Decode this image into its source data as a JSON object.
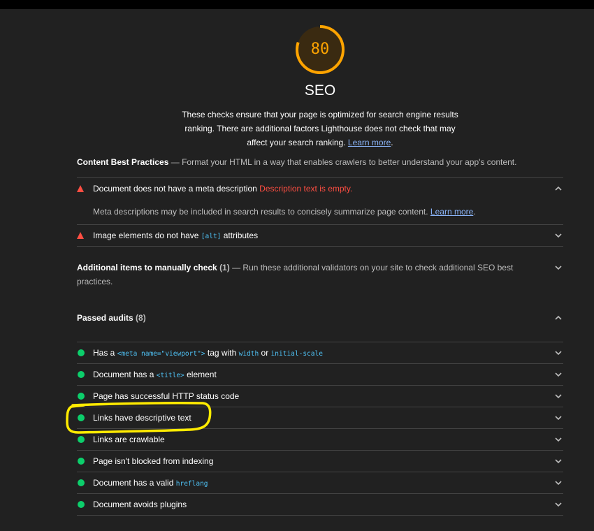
{
  "score": {
    "value": "80",
    "fraction": 0.8,
    "color": "#ffa400"
  },
  "category": {
    "title": "SEO",
    "description": "These checks ensure that your page is optimized for search engine results ranking. There are additional factors Lighthouse does not check that may affect your search ranking.",
    "learn_more": "Learn more",
    "period": "."
  },
  "content_best_practices": {
    "title": "Content Best Practices",
    "separator": "—",
    "description": "Format your HTML in a way that enables crawlers to better understand your app's content."
  },
  "failed_audits": [
    {
      "title": "Document does not have a meta description",
      "error": "Description text is empty.",
      "expanded_description": "Meta descriptions may be included in search results to concisely summarize page content.",
      "learn_more": "Learn more",
      "period": "."
    },
    {
      "title_before": "Image elements do not have",
      "code": "[alt]",
      "title_after": "attributes"
    }
  ],
  "manual": {
    "title": "Additional items to manually check",
    "count": "(1)",
    "separator": "—",
    "description": "Run these additional validators on your site to check additional SEO best practices."
  },
  "passed": {
    "title": "Passed audits",
    "count": "(8)",
    "audits": [
      {
        "before": "Has a",
        "code1": "<meta name=\"viewport\">",
        "middle": "tag with",
        "code2": "width",
        "and": "or",
        "code3": "initial-scale"
      },
      {
        "before": "Document has a",
        "code": "<title>",
        "after": "element"
      },
      {
        "label": "Page has successful HTTP status code"
      },
      {
        "label": "Links have descriptive text"
      },
      {
        "label": "Links are crawlable"
      },
      {
        "label": "Page isn't blocked from indexing"
      },
      {
        "before": "Document has a valid",
        "code": "hreflang"
      },
      {
        "label": "Document avoids plugins"
      }
    ]
  },
  "colors": {
    "fail": "#ff4e42",
    "pass": "#0cce6b",
    "average": "#ffa400",
    "link": "#8ab4f8",
    "code": "#4fc3f7",
    "highlight": "#ffeb00"
  }
}
